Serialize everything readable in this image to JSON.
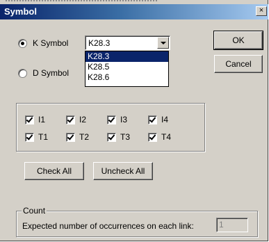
{
  "window": {
    "title": "Symbol",
    "close_glyph": "×"
  },
  "symbol_type": {
    "k_label": "K Symbol",
    "d_label": "D Symbol",
    "selected": "K Symbol"
  },
  "k_combo": {
    "value": "K28.3",
    "options": [
      "K28.3",
      "K28.5",
      "K28.6"
    ],
    "highlighted": "K28.3"
  },
  "buttons": {
    "ok": "OK",
    "cancel": "Cancel",
    "check_all": "Check All",
    "uncheck_all": "Uncheck All"
  },
  "checkboxes": {
    "row1": [
      {
        "label": "I1",
        "checked": true
      },
      {
        "label": "I2",
        "checked": true
      },
      {
        "label": "I3",
        "checked": true
      },
      {
        "label": "I4",
        "checked": true
      }
    ],
    "row2": [
      {
        "label": "T1",
        "checked": true
      },
      {
        "label": "T2",
        "checked": true
      },
      {
        "label": "T3",
        "checked": true
      },
      {
        "label": "T4",
        "checked": true
      }
    ]
  },
  "count": {
    "legend": "Count",
    "label": "Expected number of occurrences on each link:",
    "value": "1"
  }
}
